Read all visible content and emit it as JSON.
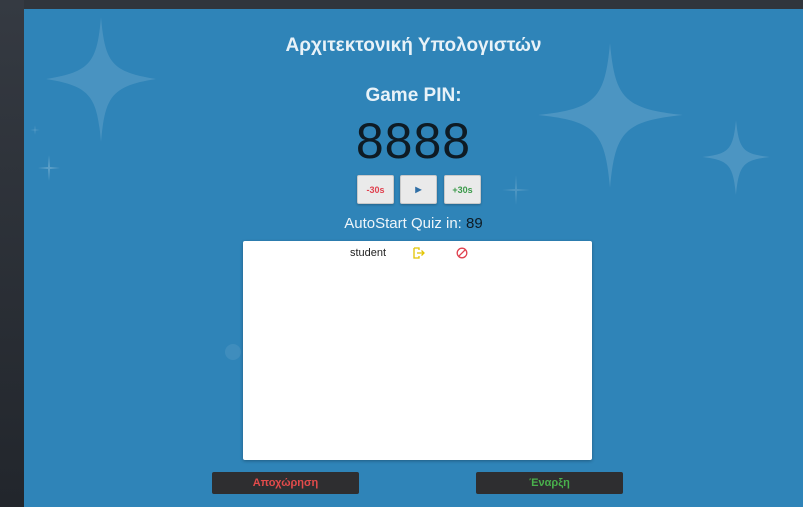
{
  "header": {
    "title": "Αρχιτεκτονική Υπολογιστών"
  },
  "game": {
    "pin_label": "Game PIN:",
    "pin": "8888",
    "autostart_label": "AutoStart Quiz in:",
    "autostart_seconds": "89"
  },
  "controls": {
    "minus_label": "-30s",
    "play_symbol": "▶",
    "plus_label": "+30s"
  },
  "players": [
    {
      "name": "student",
      "kick_icon": "logout-icon",
      "ban_icon": "ban-icon"
    }
  ],
  "footer": {
    "cancel_label": "Αποχώρηση",
    "start_label": "Έναρξη"
  },
  "colors": {
    "stage_bg": "#2f84b8",
    "cancel_text": "#e34b4b",
    "start_text": "#49b04c",
    "kick_icon": "#e2c400",
    "ban_icon": "#e0414f"
  }
}
